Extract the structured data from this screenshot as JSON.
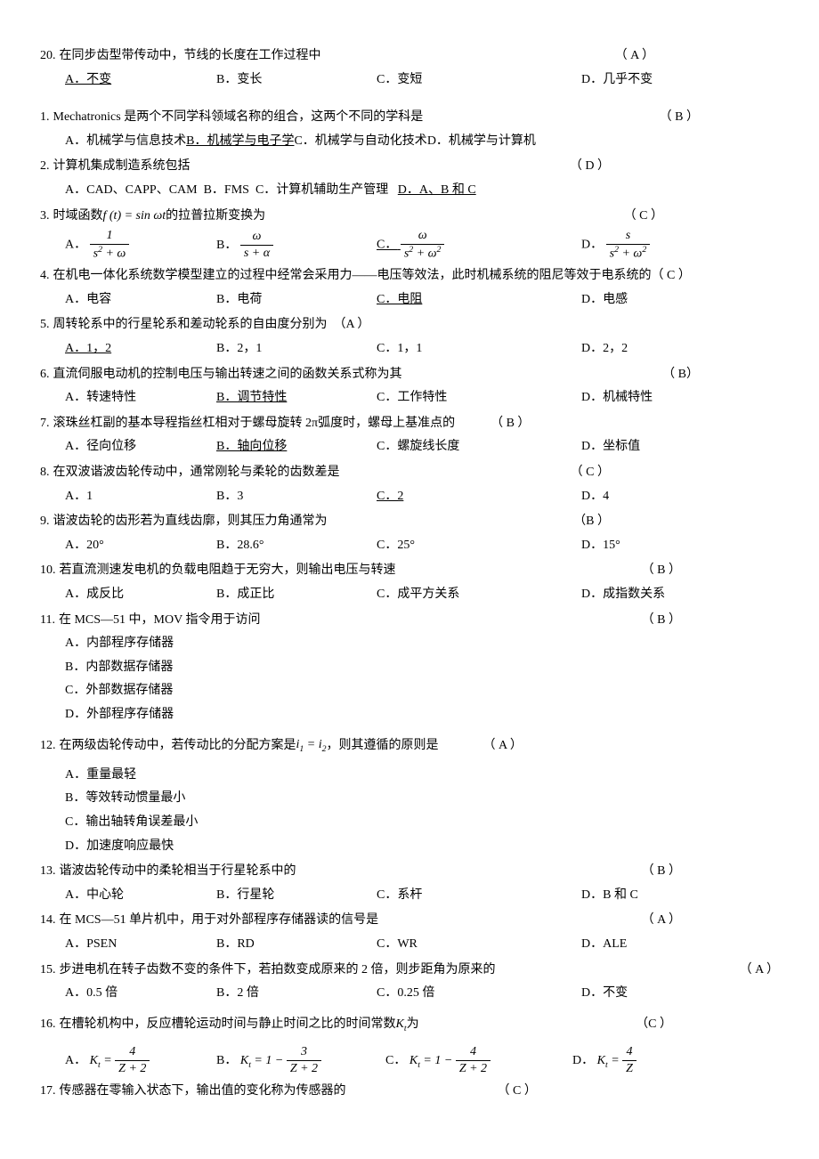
{
  "q20": {
    "num": "20.",
    "text": "在同步齿型带传动中，节线的长度在工作过程中",
    "ans": "（ A ）",
    "a": "A．不变",
    "b": "B．变长",
    "c": "C．变短",
    "d": "D．几乎不变"
  },
  "q1": {
    "num": "1.",
    "text": "Mechatronics 是两个不同学科领域名称的组合，这两个不同的学科是",
    "ans": "（ B ）",
    "a": "A．机械学与信息技术",
    "b": "B．机械学与电子学",
    "c": "C．机械学与自动化技术",
    "d": "D．机械学与计算机"
  },
  "q2": {
    "num": "2.",
    "text": "计算机集成制造系统包括",
    "ans": "（ D ）",
    "a": "A．CAD、CAPP、CAM",
    "b": "B．FMS",
    "c": "C．计算机辅助生产管理",
    "d": "D．A、B 和 C"
  },
  "q3": {
    "num": "3.",
    "text_pre": "时域函数 ",
    "text_post": " 的拉普拉斯变换为",
    "ans": "（ C ）",
    "a": "A．",
    "b": "B．",
    "c": "C．",
    "d": "D．"
  },
  "q4": {
    "num": "4.",
    "text": "在机电一体化系统数学模型建立的过程中经常会采用力——电压等效法，此时机械系统的阻尼等效于电系统的",
    "ans": "（ C ）",
    "a": "A．电容",
    "b": "B．电荷",
    "c": "C．电阻",
    "d": "D．电感"
  },
  "q5": {
    "num": "5.",
    "text": "周转轮系中的行星轮系和差动轮系的自由度分别为",
    "ans": "（A  ）",
    "a": "A．1，2",
    "b": "B．2，1",
    "c": "C．1，1",
    "d": "D．2，2"
  },
  "q6": {
    "num": "6.",
    "text": "直流伺服电动机的控制电压与输出转速之间的函数关系式称为其",
    "ans": "（ B）",
    "a": "A．转速特性",
    "b": "B．调节特性",
    "c": "C．工作特性",
    "d": "D．机械特性"
  },
  "q7": {
    "num": "7.",
    "text": "滚珠丝杠副的基本导程指丝杠相对于螺母旋转 2π弧度时，螺母上基准点的",
    "ans": "（ B ）",
    "a": "A．径向位移",
    "b": "B．轴向位移",
    "c": "C．螺旋线长度",
    "d": "D．坐标值"
  },
  "q8": {
    "num": "8.",
    "text": "在双波谐波齿轮传动中，通常刚轮与柔轮的齿数差是",
    "ans": "（ C ）",
    "a": "A．1",
    "b": "B．3",
    "c": "C．2",
    "d": "D．4"
  },
  "q9": {
    "num": "9.",
    "text": "谐波齿轮的齿形若为直线齿廓，则其压力角通常为",
    "ans": "（B  ）",
    "a": "A．20°",
    "b": "B．28.6°",
    "c": "C．25°",
    "d": "D．15°"
  },
  "q10": {
    "num": "10.",
    "text": "若直流测速发电机的负载电阻趋于无穷大，则输出电压与转速",
    "ans": "（ B ）",
    "a": "A．成反比",
    "b": "B．成正比",
    "c": "C．成平方关系",
    "d": "D．成指数关系"
  },
  "q11": {
    "num": "11.",
    "text": "在 MCS—51 中，MOV 指令用于访问",
    "ans": "（ B ）",
    "a": "A．内部程序存储器",
    "b": "B．内部数据存储器",
    "c": "C．外部数据存储器",
    "d": "D．外部程序存储器"
  },
  "q12": {
    "num": "12.",
    "text_pre": "在两级齿轮传动中，若传动比的分配方案是 ",
    "text_post": "，则其遵循的原则是",
    "ans": "（ A ）",
    "a": "A．重量最轻",
    "b": "B．等效转动惯量最小",
    "c": "C．输出轴转角误差最小",
    "d": "D．加速度响应最快"
  },
  "q13": {
    "num": "13.",
    "text": "谐波齿轮传动中的柔轮相当于行星轮系中的",
    "ans": "（ B ）",
    "a": "A．中心轮",
    "b": "B．行星轮",
    "c": "C．系杆",
    "d": "D．B 和 C"
  },
  "q14": {
    "num": "14.",
    "text": "在 MCS—51 单片机中，用于对外部程序存储器读的信号是",
    "ans": "（ A ）",
    "a": "A．PSEN",
    "b": "B．RD",
    "c": "C．WR",
    "d": "D．ALE"
  },
  "q15": {
    "num": "15.",
    "text": "步进电机在转子齿数不变的条件下，若拍数变成原来的 2 倍，则步距角为原来的",
    "ans": "（ A ）",
    "a": "A．0.5 倍",
    "b": "B．2 倍",
    "c": "C．0.25 倍",
    "d": "D．不变"
  },
  "q16": {
    "num": "16.",
    "text_pre": "在槽轮机构中，反应槽轮运动时间与静止时间之比的时间常数 ",
    "text_post": " 为",
    "ans": "（C  ）",
    "a": "A．",
    "b": "B．",
    "c": "C．",
    "d": "D．"
  },
  "q17": {
    "num": "17.",
    "text": "传感器在零输入状态下，输出值的变化称为传感器的",
    "ans": "（ C ）"
  }
}
